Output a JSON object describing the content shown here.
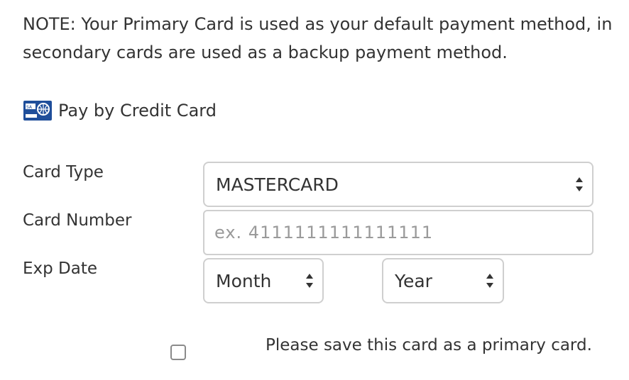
{
  "note": {
    "line1": "NOTE: Your Primary Card is used as your default payment method, in",
    "line2": "secondary cards are used as a backup payment method."
  },
  "payment": {
    "method_label": "Pay by Credit Card",
    "icon": "credit-card-icon"
  },
  "form": {
    "card_type": {
      "label": "Card Type",
      "value": "MASTERCARD"
    },
    "card_number": {
      "label": "Card Number",
      "placeholder": "ex. 4111111111111111",
      "value": ""
    },
    "exp_date": {
      "label": "Exp Date",
      "month_value": "Month",
      "year_value": "Year"
    },
    "primary_card": {
      "checked": false,
      "label": "Please save this card as a primary card."
    }
  },
  "colors": {
    "text": "#333333",
    "border": "#cfcfcf",
    "placeholder": "#9a9a9a",
    "icon_blue": "#1f4e9a"
  }
}
